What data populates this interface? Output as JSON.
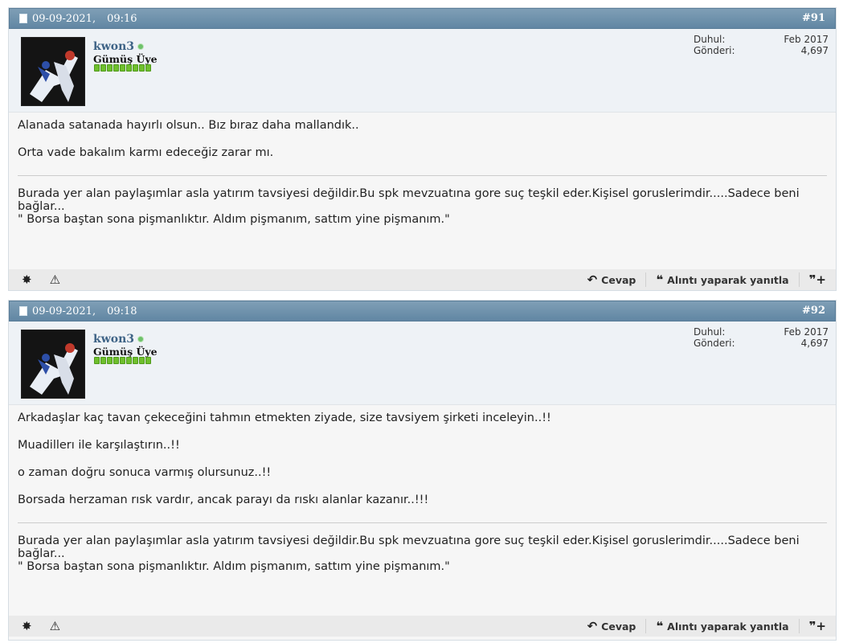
{
  "posts": [
    {
      "date": "09-09-2021,",
      "time": "09:16",
      "number": "#91",
      "username": "kwon3",
      "rank": "Gümüş Üye",
      "joined_label": "Duhul:",
      "joined_value": "Feb 2017",
      "posts_label": "Gönderi:",
      "posts_value": "4,697",
      "paragraphs": [
        "Alanada satanada hayırlı olsun.. Bız bıraz daha mallandık..",
        "Orta vade bakalım karmı edeceğiz zarar mı."
      ],
      "signature_1": "Burada yer alan paylaşımlar asla yatırım tavsiyesi değildir.Bu spk mevzuatına gore suç teşkil eder.Kişisel goruslerimdir.....Sadece beni bağlar...",
      "signature_2": "\" Borsa baştan sona pişmanlıktır. Aldım pişmanım, sattım yine pişmanım.\""
    },
    {
      "date": "09-09-2021,",
      "time": "09:18",
      "number": "#92",
      "username": "kwon3",
      "rank": "Gümüş Üye",
      "joined_label": "Duhul:",
      "joined_value": "Feb 2017",
      "posts_label": "Gönderi:",
      "posts_value": "4,697",
      "paragraphs": [
        "Arkadaşlar kaç tavan çekeceğini tahmın etmekten ziyade, size tavsiyem şirketi inceleyin..!!",
        "Muadillerı ile karşılaştırın..!!",
        "o zaman doğru sonuca varmış olursunuz..!!",
        "Borsada herzaman rısk vardır, ancak parayı da rıskı alanlar kazanır..!!!"
      ],
      "signature_1": "Burada yer alan paylaşımlar asla yatırım tavsiyesi değildir.Bu spk mevzuatına gore suç teşkil eder.Kişisel goruslerimdir.....Sadece beni bağlar...",
      "signature_2": "\" Borsa baştan sona pişmanlıktır. Aldım pişmanım, sattım yine pişmanım.\""
    }
  ],
  "actions": {
    "reply": "Cevap",
    "quote": "Alıntı yaparak yanıtla"
  },
  "icons": {
    "post": "document-icon",
    "thanks": "star-burst-icon",
    "report": "warning-icon",
    "reply": "reply-arrow-icon",
    "quote": "quote-bubble-icon",
    "multiquote": "multiquote-plus-icon"
  },
  "colors": {
    "header": "#6186a3",
    "username": "#3e6386",
    "online": "#6ec26a",
    "reputation": "#6fbf2d"
  }
}
